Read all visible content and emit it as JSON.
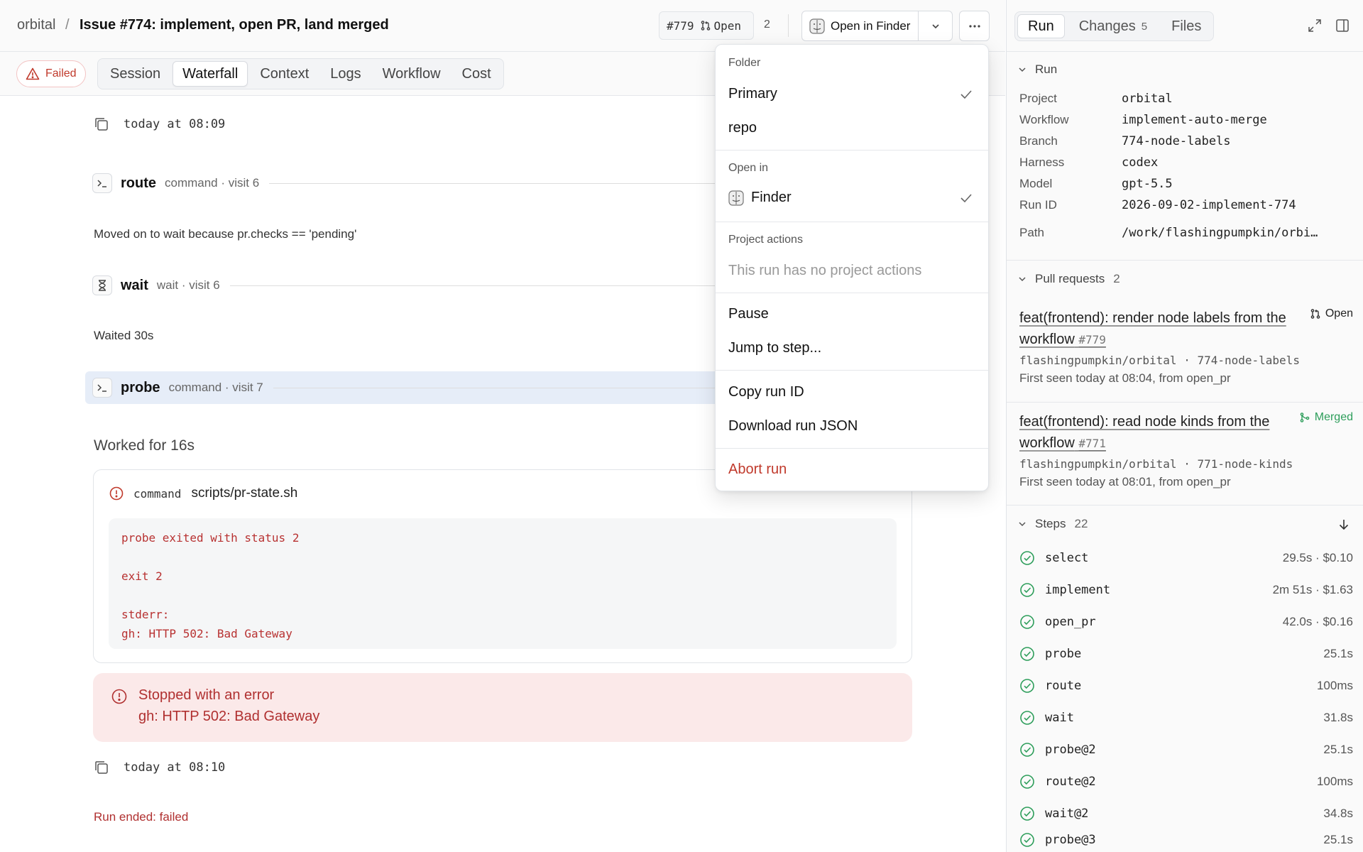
{
  "header": {
    "project": "orbital",
    "separator": "/",
    "title": "Issue #774: implement, open PR, land merged",
    "pr_chip": {
      "number": "#779",
      "state": "Open"
    },
    "pr_count": "2",
    "open_in_label": "Open in Finder"
  },
  "tabs": {
    "status": "Failed",
    "items": [
      "Session",
      "Waterfall",
      "Context",
      "Logs",
      "Workflow",
      "Cost"
    ],
    "active": "Waterfall"
  },
  "timeline": {
    "start_time": "today at 08:09",
    "nodes": [
      {
        "name": "route",
        "meta": "command · visit 6",
        "note": "Moved on to wait because pr.checks == 'pending'"
      },
      {
        "name": "wait",
        "meta": "wait · visit 6",
        "note": "Waited 30s"
      },
      {
        "name": "probe",
        "meta": "command · visit 7"
      }
    ],
    "worked": "Worked for 16s",
    "command": {
      "kind": "command",
      "script": "scripts/pr-state.sh",
      "output": "probe exited with status 2\n\nexit 2\n\nstderr:\ngh: HTTP 502: Bad Gateway"
    },
    "error": {
      "title": "Stopped with an error",
      "detail": "gh: HTTP 502: Bad Gateway"
    },
    "end_time": "today at 08:10",
    "run_ended": "Run ended: failed"
  },
  "menu": {
    "folder_header": "Folder",
    "folder_items": [
      "Primary",
      "repo"
    ],
    "open_in_header": "Open in",
    "open_in_item": "Finder",
    "project_actions_header": "Project actions",
    "project_actions_empty": "This run has no project actions",
    "pause": "Pause",
    "jump": "Jump to step...",
    "copy_id": "Copy run ID",
    "download": "Download run JSON",
    "abort": "Abort run"
  },
  "sidebar": {
    "tabs": [
      {
        "label": "Run",
        "count": ""
      },
      {
        "label": "Changes",
        "count": "5"
      },
      {
        "label": "Files",
        "count": ""
      }
    ],
    "run_section": "Run",
    "run": {
      "project": {
        "k": "Project",
        "v": "orbital"
      },
      "workflow": {
        "k": "Workflow",
        "v": "implement-auto-merge"
      },
      "branch": {
        "k": "Branch",
        "v": "774-node-labels"
      },
      "harness": {
        "k": "Harness",
        "v": "codex"
      },
      "model": {
        "k": "Model",
        "v": "gpt-5.5"
      },
      "run_id": {
        "k": "Run ID",
        "v": "2026-09-02-implement-774"
      },
      "path": {
        "k": "Path",
        "v": "/work/flashingpumpkin/orbi…"
      }
    },
    "pr_section": "Pull requests",
    "pr_count": "2",
    "prs": [
      {
        "title": "feat(frontend): render node labels from the workflow",
        "number": "#779",
        "state": "Open",
        "repo": "flashingpumpkin/orbital · 774-node-labels",
        "seen": "First seen today at 08:04, from open_pr"
      },
      {
        "title": "feat(frontend): read node kinds from the workflow",
        "number": "#771",
        "state": "Merged",
        "repo": "flashingpumpkin/orbital · 771-node-kinds",
        "seen": "First seen today at 08:01, from open_pr"
      }
    ],
    "steps_section": "Steps",
    "steps_count": "22",
    "steps": [
      {
        "name": "select",
        "dur": "29.5s · $0.10"
      },
      {
        "name": "implement",
        "dur": "2m 51s · $1.63"
      },
      {
        "name": "open_pr",
        "dur": "42.0s · $0.16"
      },
      {
        "name": "probe",
        "dur": "25.1s"
      },
      {
        "name": "route",
        "dur": "100ms"
      },
      {
        "name": "wait",
        "dur": "31.8s"
      },
      {
        "name": "probe@2",
        "dur": "25.1s"
      },
      {
        "name": "route@2",
        "dur": "100ms"
      },
      {
        "name": "wait@2",
        "dur": "34.8s"
      },
      {
        "name": "probe@3",
        "dur": "25.1s"
      }
    ]
  },
  "colors": {
    "error": "#c0392b",
    "success": "#2e9e5b",
    "highlight": "#e6edf8"
  }
}
